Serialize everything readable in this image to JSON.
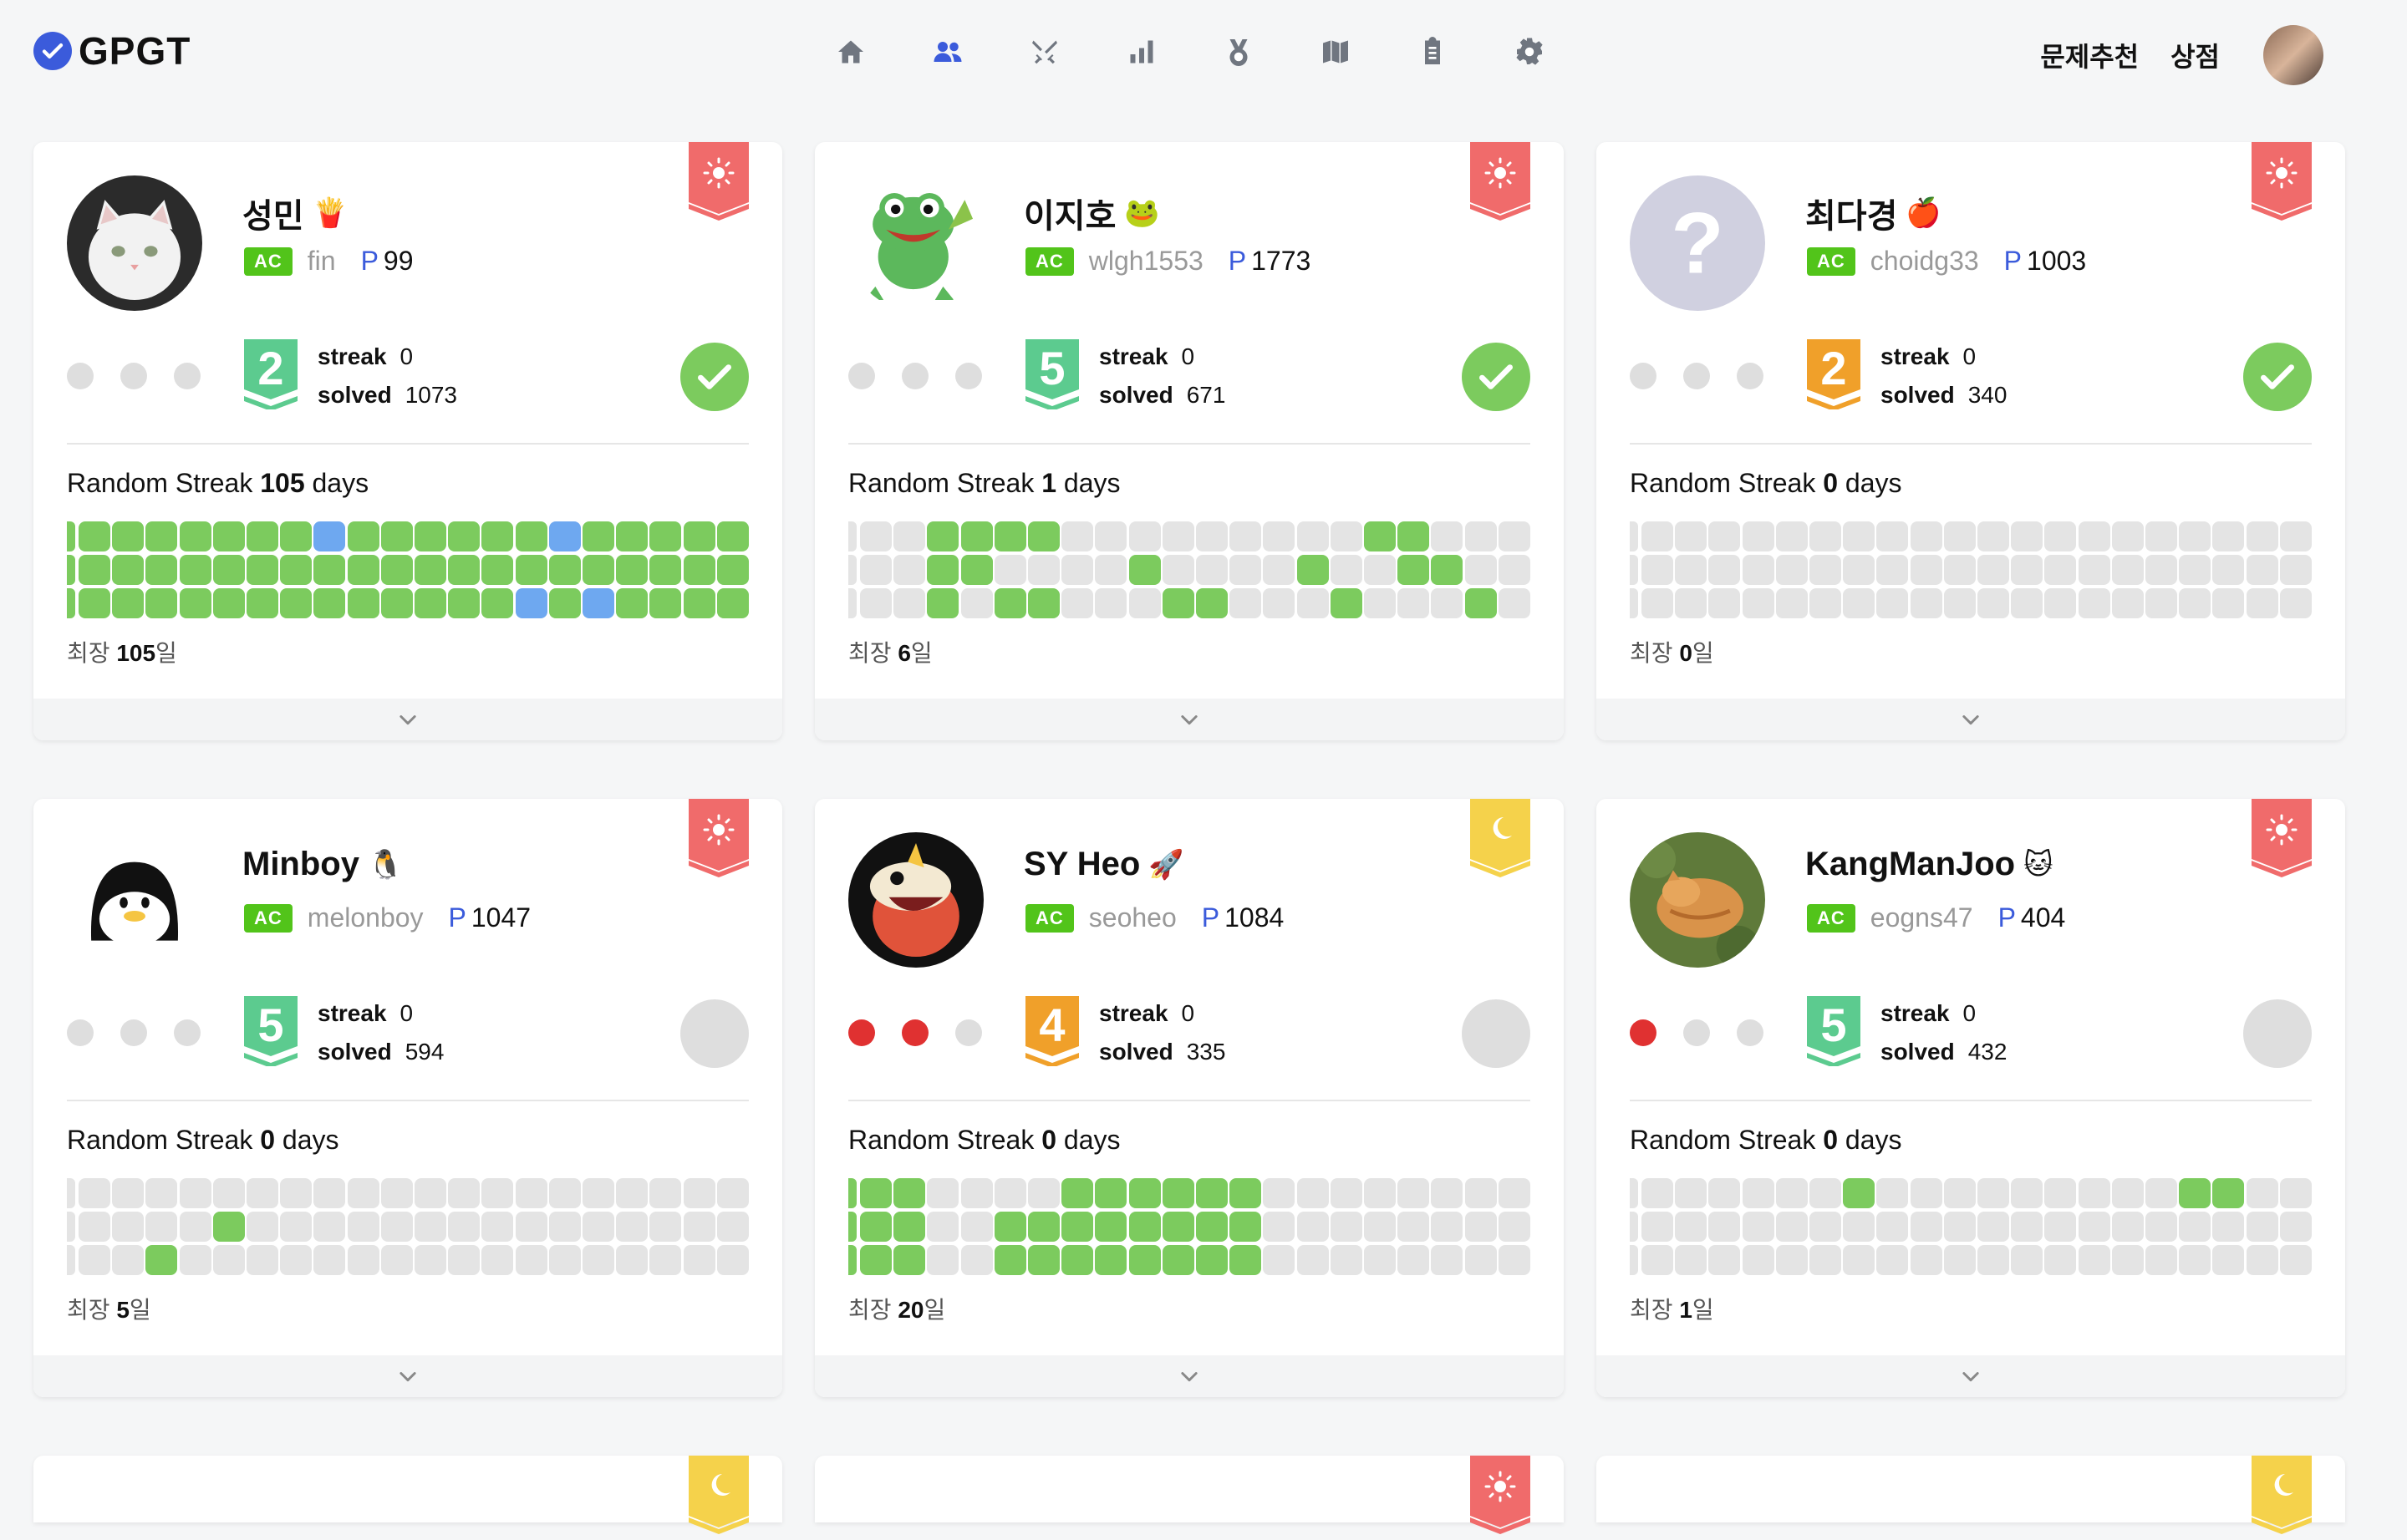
{
  "app": {
    "title": "GPGT"
  },
  "nav": [
    {
      "icon": "home-icon"
    },
    {
      "icon": "users-icon",
      "active": true
    },
    {
      "icon": "swords-icon"
    },
    {
      "icon": "bar-chart-icon"
    },
    {
      "icon": "medal-icon"
    },
    {
      "icon": "map-icon"
    },
    {
      "icon": "clipboard-icon"
    },
    {
      "icon": "gear-icon"
    }
  ],
  "topright": {
    "recommend_label": "문제추천",
    "shop_label": "상점"
  },
  "labels": {
    "streak": "streak",
    "solved": "solved",
    "random_streak": "Random Streak",
    "days": "days",
    "longest_prefix": "최장",
    "longest_suffix": "일",
    "ac": "AC",
    "points_prefix": "P"
  },
  "colors": {
    "accent": "#3b5bdb",
    "green": "#7ccb5e",
    "blue": "#6ea8f0",
    "red": "#e03131",
    "ribbon_sun": "#f06b6b",
    "ribbon_moon": "#f5d24b",
    "tier_green": "#5ccb8f",
    "tier_orange": "#f0a02a"
  },
  "cards": [
    {
      "name": "성민",
      "emoji": "🍟",
      "handle": "fin",
      "points": "99",
      "ribbon": "sun",
      "dots": [
        "off",
        "off",
        "off"
      ],
      "tier": "2",
      "tier_color": "green",
      "streak": "0",
      "solved": "1073",
      "done": true,
      "random_streak": "105",
      "longest": "105",
      "avatar": "white-cat-photo",
      "calendar": [
        "gggggggbggggggbggggg",
        "gggggggggggggggggggg",
        "gggggggggggggbgbgggg"
      ]
    },
    {
      "name": "이지호",
      "emoji": "🐸",
      "handle": "wlgh1553",
      "points": "1773",
      "ribbon": "sun",
      "dots": [
        "off",
        "off",
        "off"
      ],
      "tier": "5",
      "tier_color": "green",
      "streak": "0",
      "solved": "671",
      "done": true,
      "random_streak": "1",
      "longest": "6",
      "avatar": "frog-cartoon",
      "calendar": [
        "..gggg.........gg..",
        "..gg....g....g..gg..",
        "..g.gg...gg...g...g"
      ]
    },
    {
      "name": "최다경",
      "emoji": "🍎",
      "handle": "choidg33",
      "points": "1003",
      "ribbon": "sun",
      "dots": [
        "off",
        "off",
        "off"
      ],
      "tier": "2",
      "tier_color": "orange",
      "streak": "0",
      "solved": "340",
      "done": true,
      "random_streak": "0",
      "longest": "0",
      "avatar": "question-mark",
      "calendar": [
        "....................",
        "....................",
        "...................."
      ]
    },
    {
      "name": "Minboy",
      "emoji": "🐧",
      "handle": "melonboy",
      "points": "1047",
      "ribbon": "sun",
      "dots": [
        "off",
        "off",
        "off"
      ],
      "tier": "5",
      "tier_color": "green",
      "streak": "0",
      "solved": "594",
      "done": false,
      "random_streak": "0",
      "longest": "5",
      "avatar": "penguin-cartoon",
      "calendar": [
        "....................",
        "....g...............",
        "..g................."
      ]
    },
    {
      "name": "SY Heo",
      "emoji": "🚀",
      "handle": "seoheo",
      "points": "1084",
      "ribbon": "moon",
      "dots": [
        "red",
        "red",
        "off"
      ],
      "tier": "4",
      "tier_color": "orange",
      "streak": "0",
      "solved": "335",
      "done": false,
      "random_streak": "0",
      "longest": "20",
      "avatar": "fuecoco-cartoon",
      "calendar": [
        "gg....gggggg........",
        "gg..gggggggg........",
        "gg..gggggggg........"
      ]
    },
    {
      "name": "KangManJoo",
      "emoji": "🐱",
      "handle": "eogns47",
      "points": "404",
      "ribbon": "sun",
      "dots": [
        "red",
        "off",
        "off"
      ],
      "tier": "5",
      "tier_color": "green",
      "streak": "0",
      "solved": "432",
      "done": false,
      "random_streak": "0",
      "longest": "1",
      "avatar": "sleeping-cat-photo",
      "calendar": [
        "......g.........gg..",
        "....................",
        "...................."
      ]
    }
  ],
  "partial_row": [
    {
      "ribbon": "moon"
    },
    {
      "ribbon": "sun"
    },
    {
      "ribbon": "moon"
    }
  ]
}
